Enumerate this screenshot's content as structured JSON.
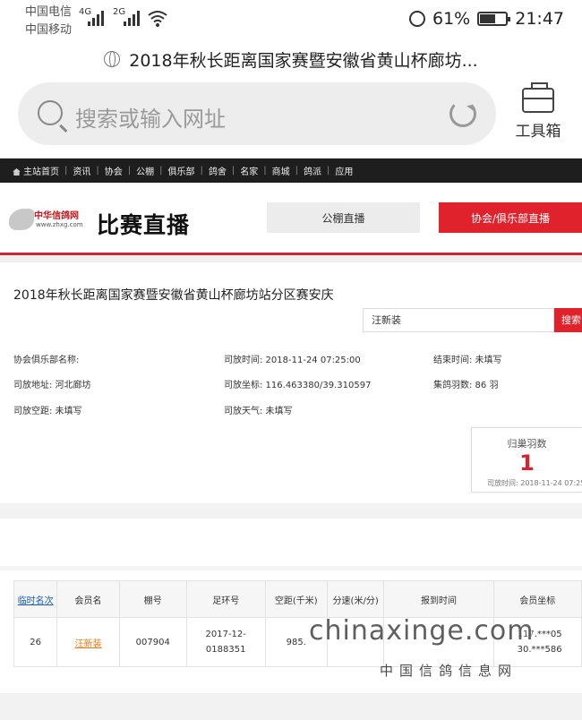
{
  "status_bar": {
    "carrier1": "中国电信",
    "carrier2": "中国移动",
    "net1": "4G",
    "net2": "2G",
    "battery": "61%",
    "battery_level": 0.61,
    "time": "21:47"
  },
  "browser": {
    "tab_title": "2018年秋长距离国家赛暨安徽省黄山杯廊坊...",
    "search_placeholder": "搜索或输入网址",
    "toolbox_label": "工具箱"
  },
  "site": {
    "nav": [
      "主站首页",
      "资讯",
      "协会",
      "公棚",
      "俱乐部",
      "鸽舍",
      "名家",
      "商城",
      "鸽派",
      "应用"
    ],
    "logo_text": "中华信鸽网",
    "logo_url": "www.zhxg.com",
    "page_heading": "比赛直播",
    "tab_gongpeng": "公棚直播",
    "tab_club": "协会/俱乐部直播",
    "colors": {
      "accent_red": "#e0222c",
      "link_blue": "#1a5dab",
      "member_orange": "#e37a1c"
    }
  },
  "race": {
    "title": "2018年秋长距离国家赛暨安徽省黄山杯廊坊站分区赛安庆",
    "search_value": "汪新装",
    "search_button": "搜索",
    "info": {
      "club_name": "协会俱乐部名称:",
      "release_time": "司放时间:  2018-11-24 07:25:00",
      "end_time": "结束时间:  未填写",
      "release_place": "司放地址:  河北廊坊",
      "release_coords": "司放坐标:  116.463380/39.310597",
      "pigeon_count": "集鸽羽数:  86 羽",
      "release_distance": "司放空距:  未填写",
      "release_weather": "司放天气:  未填写"
    },
    "returned": {
      "label": "归巢羽数",
      "value": "1",
      "time": "司放时间:  2018-11-24 07:25"
    }
  },
  "table": {
    "headers": [
      "临时名次",
      "会员名",
      "棚号",
      "足环号",
      "空距(千米)",
      "分速(米/分)",
      "报到时间",
      "会员坐标"
    ],
    "row": {
      "rank": "26",
      "member": "汪新装",
      "loft": "007904",
      "ring_line1": "2017-12-",
      "ring_line2": "0188351",
      "distance": "985.",
      "speed": "",
      "arrival": "",
      "coord_line1": "117.***05",
      "coord_line2": "30.***586"
    }
  },
  "watermark": {
    "domain": "chinaxinge.com",
    "name": "中国信鸽信息网"
  }
}
